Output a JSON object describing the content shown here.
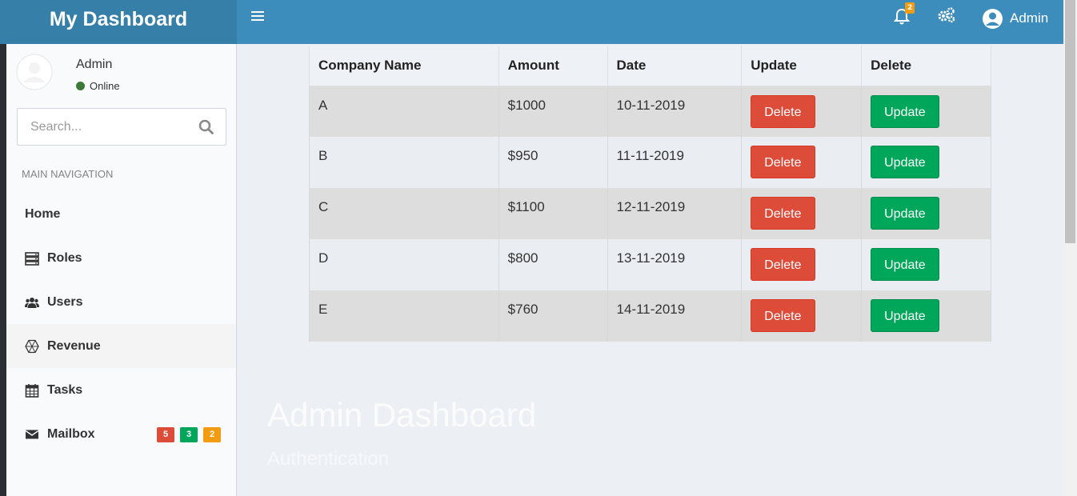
{
  "header": {
    "logo": "My Dashboard",
    "notification_count": "2",
    "user_label": "Admin",
    "icons": [
      "menu-icon",
      "bell-icon",
      "gears-icon",
      "user-circle-icon"
    ],
    "color": "#3c8dbc"
  },
  "sidebar": {
    "user": {
      "name": "Admin",
      "status": "Online"
    },
    "search": {
      "placeholder": "Search..."
    },
    "nav_header": "MAIN NAVIGATION",
    "items": [
      {
        "label": "Home",
        "icon": "none"
      },
      {
        "label": "Roles",
        "icon": "server-icon"
      },
      {
        "label": "Users",
        "icon": "users-icon"
      },
      {
        "label": "Revenue",
        "icon": "hexagon-icon",
        "active": true
      },
      {
        "label": "Tasks",
        "icon": "calendar-icon"
      },
      {
        "label": "Mailbox",
        "icon": "envelope-icon",
        "badges": [
          "5",
          "3",
          "2"
        ]
      }
    ]
  },
  "table": {
    "headers": [
      "Company Name",
      "Amount",
      "Date",
      "Update",
      "Delete"
    ],
    "rows": [
      {
        "company": "A",
        "amount": "$1000",
        "date": "10-11-2019",
        "btn1": "Delete",
        "btn2": "Update"
      },
      {
        "company": "B",
        "amount": "$950",
        "date": "11-11-2019",
        "btn1": "Delete",
        "btn2": "Update"
      },
      {
        "company": "C",
        "amount": "$1100",
        "date": "12-11-2019",
        "btn1": "Delete",
        "btn2": "Update"
      },
      {
        "company": "D",
        "amount": "$800",
        "date": "13-11-2019",
        "btn1": "Delete",
        "btn2": "Update"
      },
      {
        "company": "E",
        "amount": "$760",
        "date": "14-11-2019",
        "btn1": "Delete",
        "btn2": "Update"
      }
    ]
  },
  "content": {
    "title": "Admin Dashboard",
    "subtitle": "Authentication"
  },
  "colors": {
    "danger": "#dd4b39",
    "success": "#00a65a",
    "warning": "#f39c12"
  }
}
